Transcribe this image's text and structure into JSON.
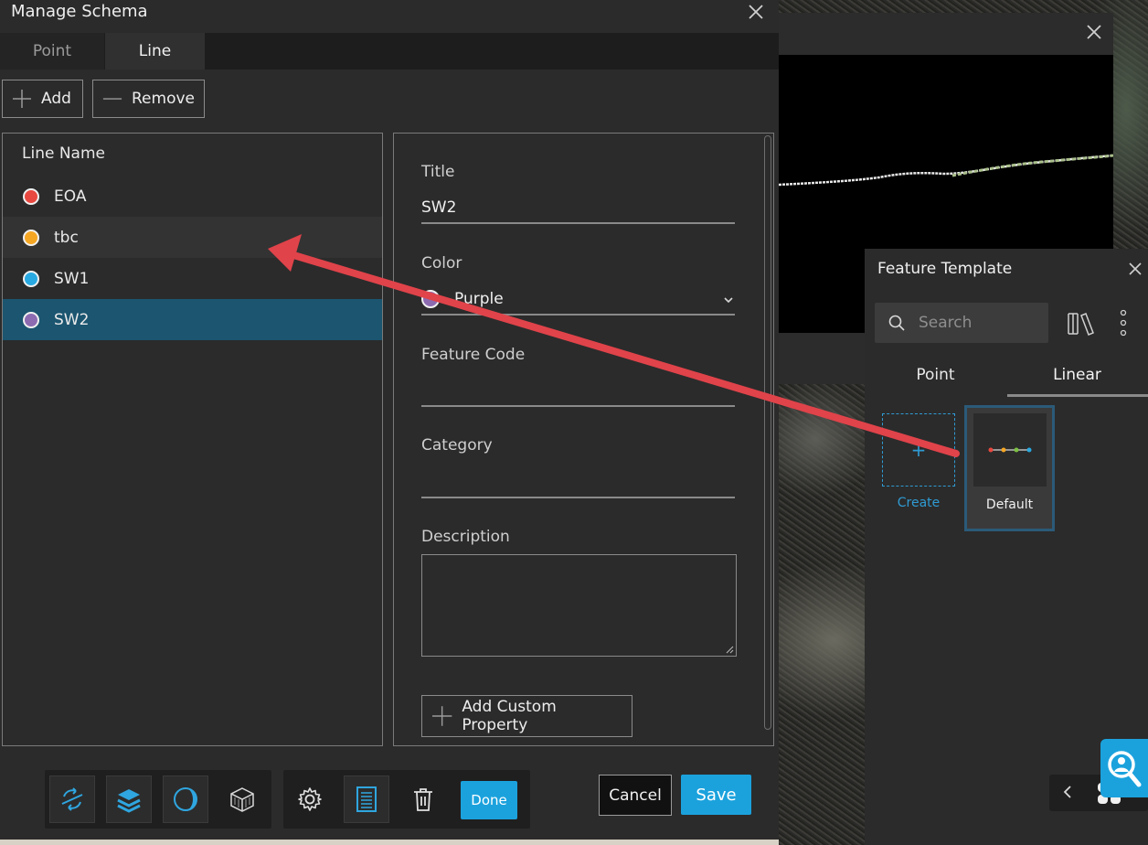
{
  "dialog": {
    "title": "Manage Schema",
    "tabs": [
      {
        "label": "Point",
        "active": false
      },
      {
        "label": "Line",
        "active": true
      }
    ],
    "add_label": "Add",
    "remove_label": "Remove",
    "list_header": "Line Name",
    "lines": [
      {
        "name": "EOA",
        "color": "#e8483f",
        "state": "normal"
      },
      {
        "name": "tbc",
        "color": "#f5a623",
        "state": "hover"
      },
      {
        "name": "SW1",
        "color": "#29a9e1",
        "state": "normal"
      },
      {
        "name": "SW2",
        "color": "#8c6bb1",
        "state": "selected"
      }
    ],
    "form": {
      "title_label": "Title",
      "title_value": "SW2",
      "color_label": "Color",
      "color_value": "Purple",
      "color_hex": "#8c6bb1",
      "feature_code_label": "Feature Code",
      "feature_code_value": "",
      "category_label": "Category",
      "category_value": "",
      "description_label": "Description",
      "description_value": "",
      "add_custom_property_label": "Add Custom Property"
    },
    "toolbar": {
      "tools": [
        "sync-icon",
        "layers-icon",
        "contrast-icon",
        "cube-icon",
        "gear-icon",
        "document-icon",
        "trash-icon"
      ],
      "done_label": "Done"
    },
    "cancel_label": "Cancel",
    "save_label": "Save"
  },
  "feature_template": {
    "title": "Feature Template",
    "search_placeholder": "Search",
    "tabs": [
      {
        "label": "Point",
        "active": false
      },
      {
        "label": "Linear",
        "active": true
      }
    ],
    "create_label": "Create",
    "default_label": "Default",
    "default_dot_colors": [
      "#e8483f",
      "#f5a623",
      "#7cc043",
      "#29a9e1"
    ]
  },
  "colors": {
    "accent": "#1ba2dd",
    "selected_row": "#1b5570",
    "annotation_arrow": "#e0434a"
  }
}
